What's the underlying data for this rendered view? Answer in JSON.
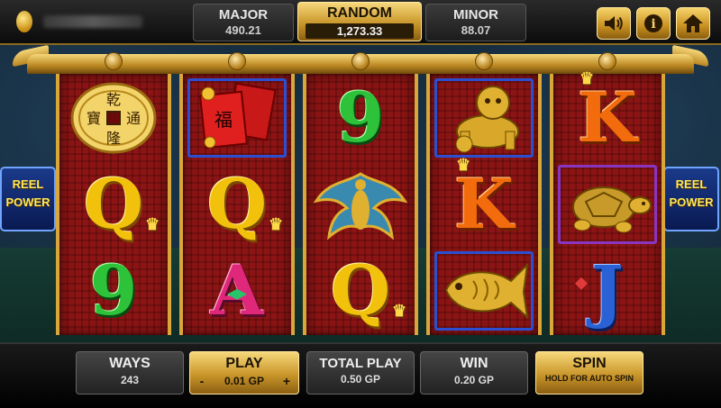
{
  "jackpots": {
    "major": {
      "label": "MAJOR",
      "value": "490.21"
    },
    "random": {
      "label": "RANDOM",
      "value": "1,273.33"
    },
    "minor": {
      "label": "MINOR",
      "value": "88.07"
    }
  },
  "header_buttons": [
    {
      "icon": "speaker-icon"
    },
    {
      "icon": "info-icon",
      "glyph": "i"
    },
    {
      "icon": "home-icon"
    }
  ],
  "side_badge": {
    "line1": "REEL",
    "line2": "POWER"
  },
  "reels": [
    [
      "Coin",
      "Q",
      "9"
    ],
    [
      "Red envelopes",
      "Q",
      "A"
    ],
    [
      "9",
      "Phoenix",
      "Q"
    ],
    [
      "Foo dog",
      "K",
      "Koi fish"
    ],
    [
      "K",
      "Turtle",
      "J"
    ]
  ],
  "coin_chars": {
    "top": "乾",
    "left": "寶",
    "right": "通",
    "bottom": "隆"
  },
  "envelope_char": "福",
  "controls": {
    "ways": {
      "label": "WAYS",
      "value": "243"
    },
    "play": {
      "label": "PLAY",
      "value": "0.01 GP",
      "minus": "-",
      "plus": "+"
    },
    "total_play": {
      "label": "TOTAL PLAY",
      "value": "0.50 GP"
    },
    "win": {
      "label": "WIN",
      "value": "0.20 GP"
    },
    "spin": {
      "label": "SPIN",
      "sub": "HOLD FOR AUTO SPIN"
    }
  },
  "colors": {
    "gold": "#d9a63a",
    "reel_red": "#8c1414",
    "frame_blue": "#2b4fd0"
  }
}
